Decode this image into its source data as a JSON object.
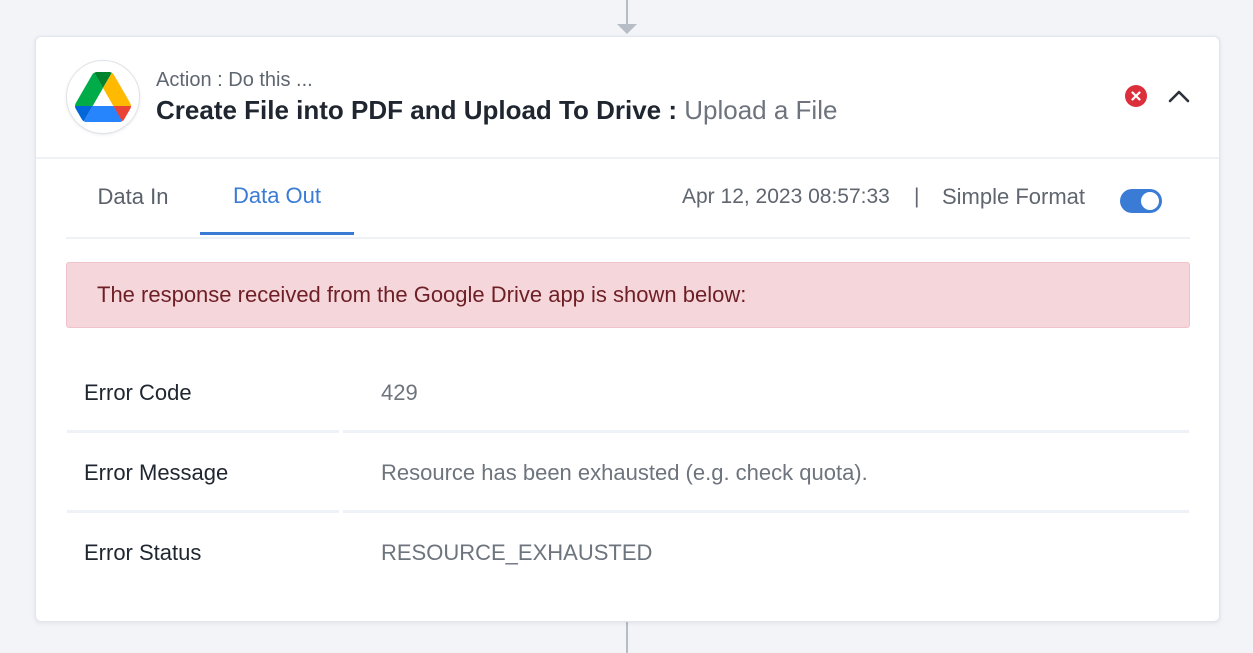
{
  "step": {
    "action_label": "Action : Do this ...",
    "title": "Create File into PDF and Upload To Drive : ",
    "event": "Upload a File",
    "app_icon": "google-drive-icon"
  },
  "tabs": [
    {
      "label": "Data In",
      "active": false
    },
    {
      "label": "Data Out",
      "active": true
    }
  ],
  "meta": {
    "timestamp": "Apr 12, 2023 08:57:33",
    "separator": "|",
    "format_label": "Simple Format",
    "format_toggle_on": true
  },
  "alert": {
    "message": "The response received from the Google Drive app is shown below:"
  },
  "response_rows": [
    {
      "key": "Error Code",
      "value": "429"
    },
    {
      "key": "Error Message",
      "value": "Resource has been exhausted (e.g. check quota)."
    },
    {
      "key": "Error Status",
      "value": "RESOURCE_EXHAUSTED"
    }
  ],
  "colors": {
    "accent": "#3a7bd5",
    "error": "#dc2f3c",
    "alert_bg": "#f5d6da",
    "alert_text": "#6e1f26"
  }
}
